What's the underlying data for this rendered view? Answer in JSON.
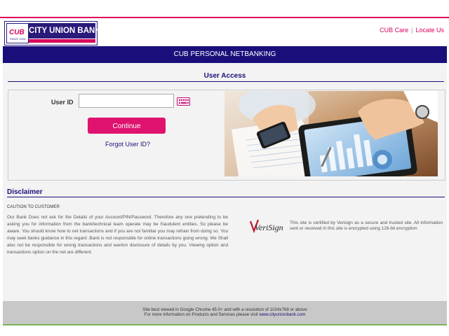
{
  "brand": {
    "emblem": "CUB",
    "emblem_since": "SINCE 1904",
    "name": "CITY UNION BANK"
  },
  "toplinks": {
    "care": "CUB Care",
    "separator": "|",
    "locate": "Locate Us"
  },
  "title": "CUB PERSONAL NETBANKING",
  "user_access": {
    "heading": "User Access",
    "user_id_label": "User ID",
    "user_id_value": "",
    "continue_label": "Continue",
    "forgot_label": "Forgot User ID?"
  },
  "disclaimer": {
    "heading": "Disclaimer",
    "caution": "CAUTION TO CUSTOMER",
    "body": "Our Bank Does not ask for the Details of your Account/PIN/Password. Therefore any one pretending to be asking you for information from the bank/technical team operate may be fraudulent entities. So please be aware. You should know how to net transactions and if you are not familiar you may refrain from doing so. You may seek banks guidance in this regard .Bank is not responsible for online transactions going wrong. We Shall also not be responsible for wrong transactions and wanton disclosure of details by you. Viewing option and transactions option on the net are different."
  },
  "verisign": {
    "logo_text": "VeriSign",
    "text": "This site is certified by Verisign as a secure and trusted site. All information sent or received in this site is encrypted using 128-bit encryption"
  },
  "footer": {
    "line1": "Site best viewed in Google Chrome 45.0+ and with a resolution of 1024x768 or above",
    "line2_prefix": "For more information on Products and Services please visit ",
    "link": "www.cityunionbank.com"
  },
  "colors": {
    "brand_navy": "#1a0f7a",
    "brand_pink": "#e0126f",
    "footer_gray": "#c8c8c8"
  },
  "icons": {
    "keyboard": "virtual-keyboard-icon"
  }
}
